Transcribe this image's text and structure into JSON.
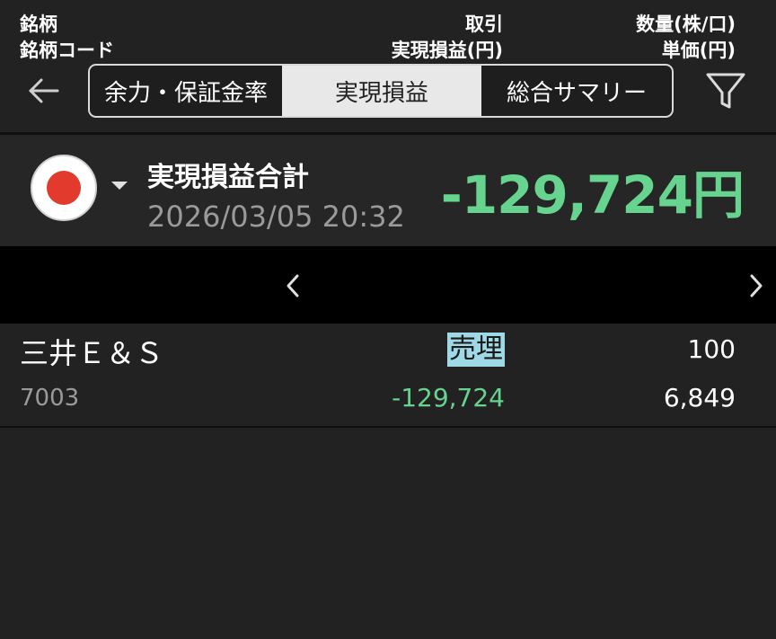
{
  "header": {
    "tabs": [
      {
        "label": "余力・保証金率",
        "selected": false
      },
      {
        "label": "実現損益",
        "selected": true
      },
      {
        "label": "総合サマリー",
        "selected": false
      }
    ],
    "back_icon": "arrow-left-icon",
    "filter_icon": "filter-icon"
  },
  "summary": {
    "market_icon": "japan-flag-icon",
    "title": "実現損益合計",
    "timestamp": "2026/03/05  20:32",
    "total": "-129,724円",
    "total_color": "#66d38e"
  },
  "table": {
    "headers": {
      "col1_line1": "銘柄",
      "col1_line2": "銘柄コード",
      "col2_line1": "取引",
      "col2_line2": "実現損益(円)",
      "col3_line1": "数量(株/口)",
      "col3_line2": "単価(円)"
    },
    "rows": [
      {
        "name": "三井Ｅ＆Ｓ",
        "code": "7003",
        "trade": "売埋",
        "realized_pl": "-129,724",
        "quantity": "100",
        "unit_price": "6,849"
      }
    ]
  },
  "colors": {
    "profit_loss_green": "#66d38e",
    "badge_bg": "#9fd9e6",
    "background": "#222222"
  }
}
